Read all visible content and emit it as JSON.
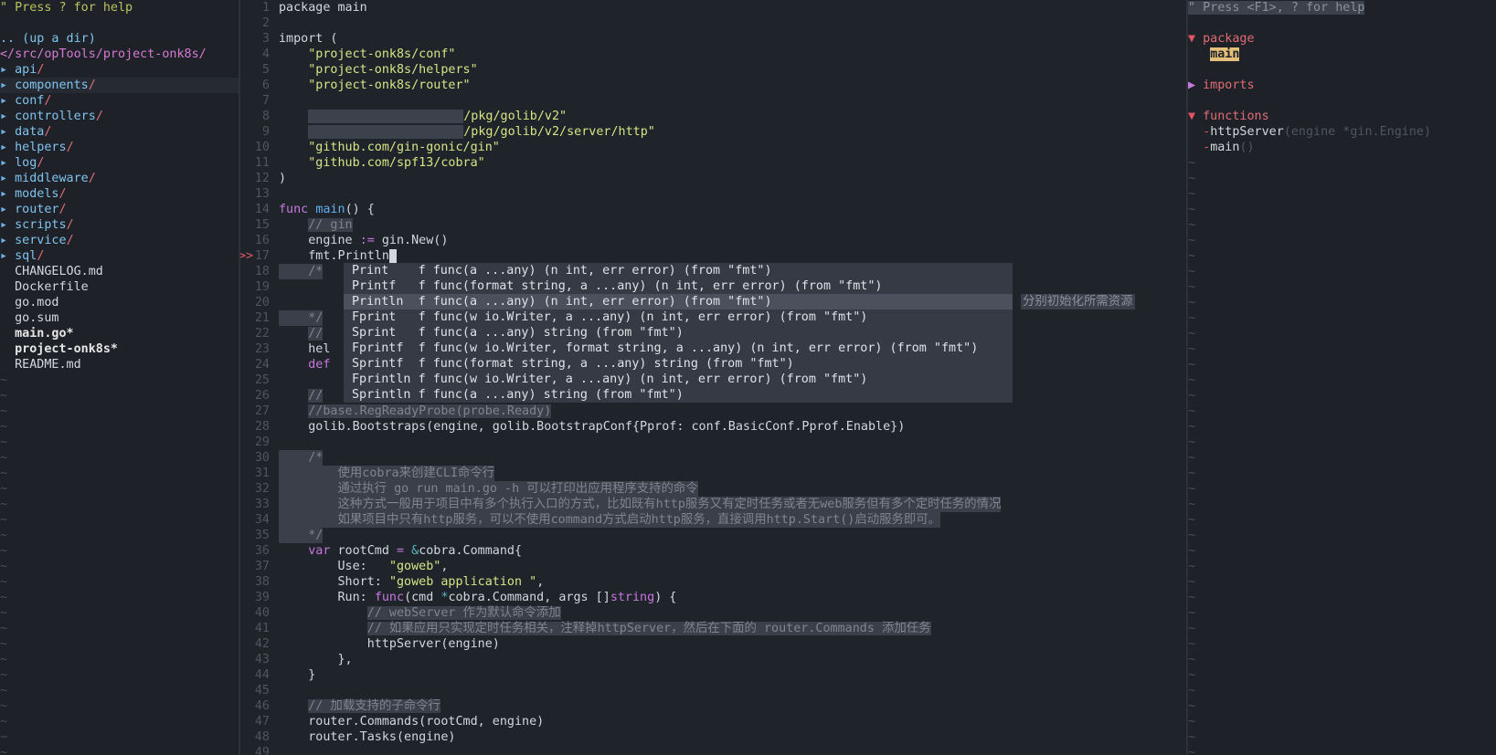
{
  "tree": {
    "help": "\" Press ? for help",
    "up_dir": ".. (up a dir)",
    "root_path": "</src/opTools/project-onk8s/",
    "dirs": [
      "api",
      "components",
      "conf",
      "controllers",
      "data",
      "helpers",
      "log",
      "middleware",
      "models",
      "router",
      "scripts",
      "service",
      "sql"
    ],
    "files": [
      "CHANGELOG.md",
      "Dockerfile",
      "go.mod",
      "go.sum"
    ],
    "modified_files": [
      "main.go*",
      "project-onk8s*"
    ],
    "files_after": [
      "README.md"
    ],
    "highlighted_dir": "components"
  },
  "editor": {
    "sign": ">>",
    "lines": {
      "l1": [
        "package main"
      ],
      "l3a": "import (",
      "l4": "\"project-onk8s/conf\"",
      "l5": "\"project-onk8s/helpers\"",
      "l6": "\"project-onk8s/router\"",
      "l8": "/pkg/golib/v2\"",
      "l9": "/pkg/golib/v2/server/http\"",
      "l10": "\"github.com/gin-gonic/gin\"",
      "l11": "\"github.com/spf13/cobra\"",
      "l12": ")",
      "l14a": "func",
      "l14b": "main",
      "l14c": "() {",
      "l15": "// gin",
      "l16a": "engine ",
      "l16b": ":=",
      "l16c": " gin.New()",
      "l17": "fmt.Println",
      "l18": "/*",
      "l21": "*/",
      "l22": "//",
      "l23": "hel",
      "l24": "def",
      "l26": "//",
      "l27": "//base.RegReadyProbe(probe.Ready)",
      "l28": "golib.Bootstraps(engine, golib.BootstrapConf{Pprof: conf.BasicConf.Pprof.Enable})",
      "l30": "/*",
      "l31": "使用cobra来创建CLI命令行",
      "l32": "通过执行 go run main.go -h 可以打印出应用程序支持的命令",
      "l33": "这种方式一般用于项目中有多个执行入口的方式，比如既有http服务又有定时任务或者无web服务但有多个定时任务的情况",
      "l34": "如果项目中只有http服务，可以不使用command方式启动http服务，直接调用http.Start()启动服务即可。",
      "l35": "*/",
      "l36a": "var",
      "l36b": " rootCmd ",
      "l36c": "=",
      "l36d": " &",
      "l36e": "cobra.Command{",
      "l37a": "Use:   ",
      "l37b": "\"goweb\"",
      "l37c": ",",
      "l38a": "Short: ",
      "l38b": "\"goweb application \"",
      "l38c": ",",
      "l39a": "Run: ",
      "l39b": "func",
      "l39c": "(cmd ",
      "l39d": "*",
      "l39e": "cobra.Command, args []",
      "l39f": "string",
      "l39g": ") {",
      "l40": "// webServer 作为默认命令添加",
      "l41": "// 如果应用只实现定时任务相关，注释掉httpServer，然后在下面的 router.Commands 添加任务",
      "l42": "httpServer(engine)",
      "l43": "},",
      "l44": "}",
      "l46": "// 加载支持的子命令行",
      "l47": "router.Commands(rootCmd, engine)",
      "l48": "router.Tasks(engine)"
    },
    "line_numbers": [
      "1",
      "2",
      "3",
      "4",
      "5",
      "6",
      "7",
      "8",
      "9",
      "10",
      "11",
      "12",
      "13",
      "14",
      "15",
      "16",
      "17",
      "18",
      "19",
      "20",
      "21",
      "22",
      "23",
      "24",
      "25",
      "26",
      "27",
      "28",
      "29",
      "30",
      "31",
      "32",
      "33",
      "34",
      "35",
      "36",
      "37",
      "38",
      "39",
      "40",
      "41",
      "42",
      "43",
      "44",
      "45",
      "46",
      "47",
      "48",
      "49"
    ]
  },
  "popup": {
    "items": [
      {
        "word": "Print   ",
        "kind": "f",
        "sig": "func(a ...any) (n int, err error) (from \"fmt\")"
      },
      {
        "word": "Printf  ",
        "kind": "f",
        "sig": "func(format string, a ...any) (n int, err error) (from \"fmt\")"
      },
      {
        "word": "Println ",
        "kind": "f",
        "sig": "func(a ...any) (n int, err error) (from \"fmt\")"
      },
      {
        "word": "Fprint  ",
        "kind": "f",
        "sig": "func(w io.Writer, a ...any) (n int, err error) (from \"fmt\")"
      },
      {
        "word": "Sprint  ",
        "kind": "f",
        "sig": "func(a ...any) string (from \"fmt\")"
      },
      {
        "word": "Fprintf ",
        "kind": "f",
        "sig": "func(w io.Writer, format string, a ...any) (n int, err error) (from \"fmt\")"
      },
      {
        "word": "Sprintf ",
        "kind": "f",
        "sig": "func(format string, a ...any) string (from \"fmt\")"
      },
      {
        "word": "Fprintln",
        "kind": "f",
        "sig": "func(w io.Writer, a ...any) (n int, err error) (from \"fmt\")"
      },
      {
        "word": "Sprintln",
        "kind": "f",
        "sig": "func(a ...any) string (from \"fmt\")"
      }
    ],
    "selected_index": 2,
    "trailing_hint": "分别初始化所需资源"
  },
  "tagbar": {
    "help": "\" Press <F1>, ? for help",
    "package_label": "package",
    "package_name": "main",
    "imports_label": "imports",
    "functions_label": "functions",
    "functions": [
      {
        "name": "httpServer",
        "sig": "(engine *gin.Engine)"
      },
      {
        "name": "main",
        "sig": "()"
      }
    ]
  }
}
